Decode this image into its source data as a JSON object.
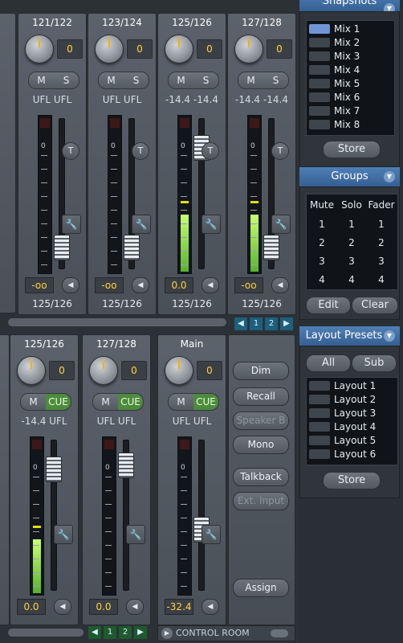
{
  "top_channels": [
    {
      "name": "121/122",
      "gain": "0",
      "btn_a": "M",
      "btn_b": "S",
      "levels": [
        "UFL",
        "UFL"
      ],
      "fader_value": "-oo",
      "footer": "125/126",
      "meter_fill": 0
    },
    {
      "name": "123/124",
      "gain": "0",
      "btn_a": "M",
      "btn_b": "S",
      "levels": [
        "UFL",
        "UFL"
      ],
      "fader_value": "-oo",
      "footer": "125/126",
      "meter_fill": 0
    },
    {
      "name": "125/126",
      "gain": "0",
      "btn_a": "M",
      "btn_b": "S",
      "levels": [
        "-14.4",
        "-14.4"
      ],
      "fader_value": "0.0",
      "footer": "125/126",
      "meter_fill": 0.36
    },
    {
      "name": "127/128",
      "gain": "0",
      "btn_a": "M",
      "btn_b": "S",
      "levels": [
        "-14.4",
        "-14.4"
      ],
      "fader_value": "-oo",
      "footer": "125/126",
      "meter_fill": 0.36
    }
  ],
  "bottom_channels": [
    {
      "name": "125/126",
      "gain": "0",
      "btn_a": "M",
      "btn_b": "CUE",
      "levels": [
        "-14.4",
        "UFL"
      ],
      "fader_value": "0.0",
      "meter_fill": 0.34
    },
    {
      "name": "127/128",
      "gain": "0",
      "btn_a": "M",
      "btn_b": "CUE",
      "levels": [
        "UFL",
        "UFL"
      ],
      "fader_value": "0.0",
      "meter_fill": 0
    }
  ],
  "main_channel": {
    "name": "Main",
    "gain": "0",
    "btn_a": "M",
    "btn_b": "CUE",
    "levels": [
      "UFL",
      "UFL"
    ],
    "fader_value": "-32.4",
    "meter_fill": 0
  },
  "control_room": {
    "buttons": [
      "Dim",
      "Recall",
      "Speaker B",
      "Mono",
      "Talkback",
      "Ext. Input",
      "Assign"
    ],
    "disabled": [
      "Speaker B",
      "Ext. Input"
    ],
    "footer_label": "CONTROL ROOM"
  },
  "top_pager": [
    "1",
    "2"
  ],
  "bottom_pager": [
    "1",
    "2"
  ],
  "snapshots": {
    "title": "Snapshots",
    "items": [
      "Mix 1",
      "Mix 2",
      "Mix 3",
      "Mix 4",
      "Mix 5",
      "Mix 6",
      "Mix 7",
      "Mix 8"
    ],
    "active_index": 0,
    "store_label": "Store"
  },
  "groups": {
    "title": "Groups",
    "headers": [
      "Mute",
      "Solo",
      "Fader"
    ],
    "rows": [
      [
        "1",
        "1",
        "1"
      ],
      [
        "2",
        "2",
        "2"
      ],
      [
        "3",
        "3",
        "3"
      ],
      [
        "4",
        "4",
        "4"
      ]
    ],
    "edit_label": "Edit",
    "clear_label": "Clear"
  },
  "layout_presets": {
    "title": "Layout Presets",
    "tabs": [
      "All",
      "Sub"
    ],
    "items": [
      "Layout 1",
      "Layout 2",
      "Layout 3",
      "Layout 4",
      "Layout 5",
      "Layout 6"
    ],
    "store_label": "Store"
  },
  "scale_label": "0",
  "icons": {
    "trim": "T",
    "wrench": "wrench-icon",
    "arrow": "◀",
    "dropdown": "▼",
    "play": "▶"
  }
}
